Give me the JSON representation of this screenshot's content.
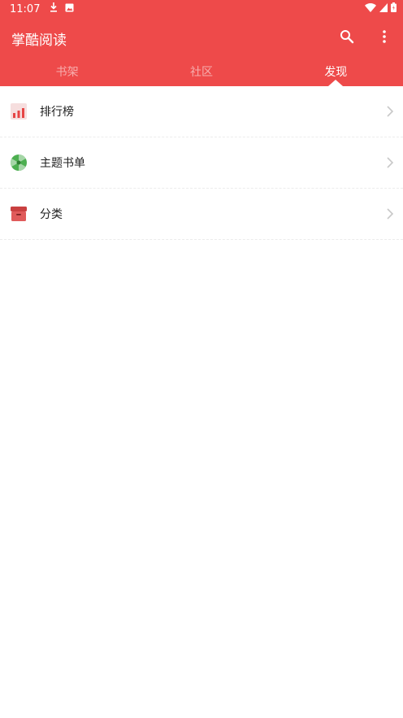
{
  "status_bar": {
    "time": "11:07",
    "left_icons": [
      "download-icon",
      "image-icon"
    ],
    "right_icons": [
      "wifi-icon",
      "signal-icon",
      "battery-icon"
    ]
  },
  "app_bar": {
    "title": "掌酷阅读",
    "actions": [
      "search-icon",
      "more-vert-icon"
    ]
  },
  "tabs": [
    {
      "label": "书架",
      "active": false
    },
    {
      "label": "社区",
      "active": false
    },
    {
      "label": "发现",
      "active": true
    }
  ],
  "discover_list": [
    {
      "label": "排行榜",
      "icon": "ranking-chart-icon"
    },
    {
      "label": "主题书单",
      "icon": "theme-booklist-icon"
    },
    {
      "label": "分类",
      "icon": "category-box-icon"
    }
  ],
  "colors": {
    "primary": "#ee4a4a",
    "tab_inactive": "rgba(255,255,255,0.55)",
    "divider": "#ececec",
    "chevron": "#c8c8c8"
  }
}
